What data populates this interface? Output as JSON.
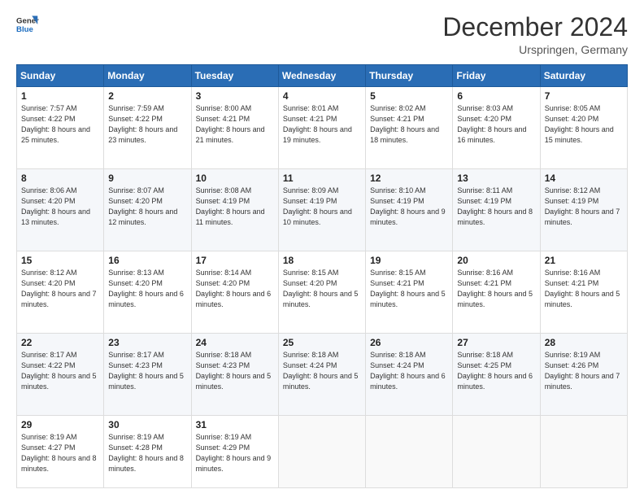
{
  "logo": {
    "line1": "General",
    "line2": "Blue"
  },
  "title": "December 2024",
  "subtitle": "Urspringen, Germany",
  "days_header": [
    "Sunday",
    "Monday",
    "Tuesday",
    "Wednesday",
    "Thursday",
    "Friday",
    "Saturday"
  ],
  "weeks": [
    [
      {
        "num": "1",
        "rise": "7:57 AM",
        "set": "4:22 PM",
        "daylight": "8 hours and 25 minutes."
      },
      {
        "num": "2",
        "rise": "7:59 AM",
        "set": "4:22 PM",
        "daylight": "8 hours and 23 minutes."
      },
      {
        "num": "3",
        "rise": "8:00 AM",
        "set": "4:21 PM",
        "daylight": "8 hours and 21 minutes."
      },
      {
        "num": "4",
        "rise": "8:01 AM",
        "set": "4:21 PM",
        "daylight": "8 hours and 19 minutes."
      },
      {
        "num": "5",
        "rise": "8:02 AM",
        "set": "4:21 PM",
        "daylight": "8 hours and 18 minutes."
      },
      {
        "num": "6",
        "rise": "8:03 AM",
        "set": "4:20 PM",
        "daylight": "8 hours and 16 minutes."
      },
      {
        "num": "7",
        "rise": "8:05 AM",
        "set": "4:20 PM",
        "daylight": "8 hours and 15 minutes."
      }
    ],
    [
      {
        "num": "8",
        "rise": "8:06 AM",
        "set": "4:20 PM",
        "daylight": "8 hours and 13 minutes."
      },
      {
        "num": "9",
        "rise": "8:07 AM",
        "set": "4:20 PM",
        "daylight": "8 hours and 12 minutes."
      },
      {
        "num": "10",
        "rise": "8:08 AM",
        "set": "4:19 PM",
        "daylight": "8 hours and 11 minutes."
      },
      {
        "num": "11",
        "rise": "8:09 AM",
        "set": "4:19 PM",
        "daylight": "8 hours and 10 minutes."
      },
      {
        "num": "12",
        "rise": "8:10 AM",
        "set": "4:19 PM",
        "daylight": "8 hours and 9 minutes."
      },
      {
        "num": "13",
        "rise": "8:11 AM",
        "set": "4:19 PM",
        "daylight": "8 hours and 8 minutes."
      },
      {
        "num": "14",
        "rise": "8:12 AM",
        "set": "4:19 PM",
        "daylight": "8 hours and 7 minutes."
      }
    ],
    [
      {
        "num": "15",
        "rise": "8:12 AM",
        "set": "4:20 PM",
        "daylight": "8 hours and 7 minutes."
      },
      {
        "num": "16",
        "rise": "8:13 AM",
        "set": "4:20 PM",
        "daylight": "8 hours and 6 minutes."
      },
      {
        "num": "17",
        "rise": "8:14 AM",
        "set": "4:20 PM",
        "daylight": "8 hours and 6 minutes."
      },
      {
        "num": "18",
        "rise": "8:15 AM",
        "set": "4:20 PM",
        "daylight": "8 hours and 5 minutes."
      },
      {
        "num": "19",
        "rise": "8:15 AM",
        "set": "4:21 PM",
        "daylight": "8 hours and 5 minutes."
      },
      {
        "num": "20",
        "rise": "8:16 AM",
        "set": "4:21 PM",
        "daylight": "8 hours and 5 minutes."
      },
      {
        "num": "21",
        "rise": "8:16 AM",
        "set": "4:21 PM",
        "daylight": "8 hours and 5 minutes."
      }
    ],
    [
      {
        "num": "22",
        "rise": "8:17 AM",
        "set": "4:22 PM",
        "daylight": "8 hours and 5 minutes."
      },
      {
        "num": "23",
        "rise": "8:17 AM",
        "set": "4:23 PM",
        "daylight": "8 hours and 5 minutes."
      },
      {
        "num": "24",
        "rise": "8:18 AM",
        "set": "4:23 PM",
        "daylight": "8 hours and 5 minutes."
      },
      {
        "num": "25",
        "rise": "8:18 AM",
        "set": "4:24 PM",
        "daylight": "8 hours and 5 minutes."
      },
      {
        "num": "26",
        "rise": "8:18 AM",
        "set": "4:24 PM",
        "daylight": "8 hours and 6 minutes."
      },
      {
        "num": "27",
        "rise": "8:18 AM",
        "set": "4:25 PM",
        "daylight": "8 hours and 6 minutes."
      },
      {
        "num": "28",
        "rise": "8:19 AM",
        "set": "4:26 PM",
        "daylight": "8 hours and 7 minutes."
      }
    ],
    [
      {
        "num": "29",
        "rise": "8:19 AM",
        "set": "4:27 PM",
        "daylight": "8 hours and 8 minutes."
      },
      {
        "num": "30",
        "rise": "8:19 AM",
        "set": "4:28 PM",
        "daylight": "8 hours and 8 minutes."
      },
      {
        "num": "31",
        "rise": "8:19 AM",
        "set": "4:29 PM",
        "daylight": "8 hours and 9 minutes."
      },
      null,
      null,
      null,
      null
    ]
  ]
}
